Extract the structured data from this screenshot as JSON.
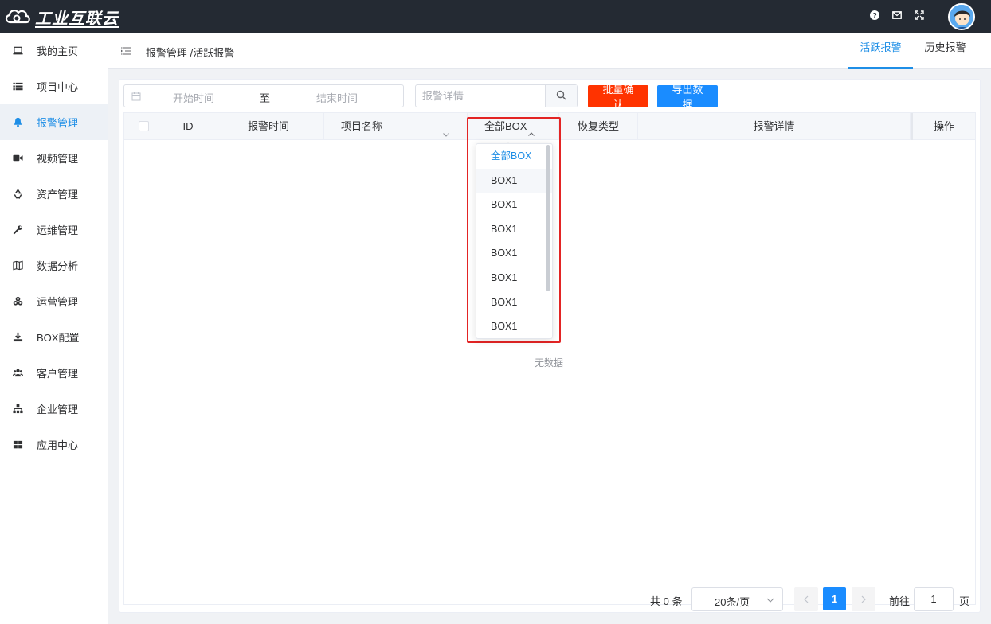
{
  "app": {
    "logo_text": "工业互联云"
  },
  "sidebar": {
    "items": [
      {
        "label": "我的主页",
        "icon": "laptop-icon",
        "active": false
      },
      {
        "label": "项目中心",
        "icon": "list-icon",
        "active": false
      },
      {
        "label": "报警管理",
        "icon": "bell-icon",
        "active": true
      },
      {
        "label": "视频管理",
        "icon": "video-camera-icon",
        "active": false
      },
      {
        "label": "资产管理",
        "icon": "recycle-icon",
        "active": false
      },
      {
        "label": "运维管理",
        "icon": "wrench-icon",
        "active": false
      },
      {
        "label": "数据分析",
        "icon": "map-icon",
        "active": false
      },
      {
        "label": "运营管理",
        "icon": "cubes-icon",
        "active": false
      },
      {
        "label": "BOX配置",
        "icon": "download-icon",
        "active": false
      },
      {
        "label": "客户管理",
        "icon": "users-icon",
        "active": false
      },
      {
        "label": "企业管理",
        "icon": "sitemap-icon",
        "active": false
      },
      {
        "label": "应用中心",
        "icon": "grid-icon",
        "active": false
      }
    ]
  },
  "header": {
    "breadcrumb": "报警管理 /活跃报警",
    "tabs": [
      {
        "label": "活跃报警",
        "active": true
      },
      {
        "label": "历史报警",
        "active": false
      }
    ]
  },
  "filters": {
    "start_placeholder": "开始时间",
    "range_separator": "至",
    "end_placeholder": "结束时间",
    "search_placeholder": "报警详情",
    "batch_confirm_label": "批量确认",
    "export_label": "导出数据"
  },
  "table": {
    "columns": {
      "id": "ID",
      "alarm_time": "报警时间",
      "project_name": "项目名称",
      "box": "全部BOX",
      "recovery_type": "恢复类型",
      "alarm_detail": "报警详情",
      "action": "操作"
    },
    "empty_text": "无数据"
  },
  "box_dropdown": {
    "options": [
      "全部BOX",
      "BOX1",
      "BOX1",
      "BOX1",
      "BOX1",
      "BOX1",
      "BOX1",
      "BOX1"
    ],
    "selected_index": 0,
    "hover_index": 1
  },
  "pagination": {
    "total_text": "共 0 条",
    "page_size": "20条/页",
    "current_page": "1",
    "goto_label": "前往",
    "goto_value": "1",
    "page_suffix": "页"
  },
  "colors": {
    "accent": "#1e8ee6",
    "danger_button": "#ff3300",
    "primary_button": "#1a8cff",
    "topbar": "#242a33",
    "highlight_box": "#e32424"
  }
}
